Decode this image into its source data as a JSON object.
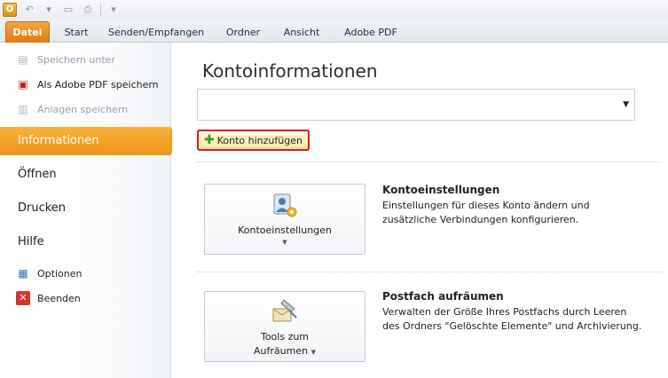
{
  "qat": {
    "app_letter": "O",
    "undo_icon": "undo-icon",
    "dropdown_icon": "chevron-down-icon",
    "save_icon": "save-icon",
    "print_icon": "print-icon"
  },
  "tabs": [
    "Datei",
    "Start",
    "Senden/Empfangen",
    "Ordner",
    "Ansicht",
    "Adobe PDF"
  ],
  "nav": {
    "commands_top": [
      {
        "label": "Speichern unter",
        "icon": "save-as-icon",
        "disabled": true
      },
      {
        "label": "Als Adobe PDF speichern",
        "icon": "adobe-pdf-icon",
        "disabled": false
      },
      {
        "label": "Anlagen speichern",
        "icon": "attachments-icon",
        "disabled": true
      }
    ],
    "items": [
      "Informationen",
      "Öffnen",
      "Drucken",
      "Hilfe"
    ],
    "commands_bottom": [
      {
        "label": "Optionen",
        "icon": "options-icon"
      },
      {
        "label": "Beenden",
        "icon": "exit-icon"
      }
    ]
  },
  "main": {
    "title": "Kontoinformationen",
    "account_select_value": "",
    "add_account_label": "Konto hinzufügen",
    "account_settings": {
      "button_label": "Kontoeinstellungen",
      "title": "Kontoeinstellungen",
      "desc_line1": "Einstellungen für dieses Konto ändern und",
      "desc_line2": "zusätzliche Verbindungen konfigurieren."
    },
    "cleanup": {
      "button_line1": "Tools zum",
      "button_line2": "Aufräumen",
      "title": "Postfach aufräumen",
      "desc_line1": "Verwalten der Größe Ihres Postfachs durch Leeren",
      "desc_line2": "des Ordners \"Gelöschte Elemente\" und Archivierung."
    }
  },
  "colors": {
    "accent_orange": "#f29c1f",
    "highlight_red": "#e0152a"
  }
}
